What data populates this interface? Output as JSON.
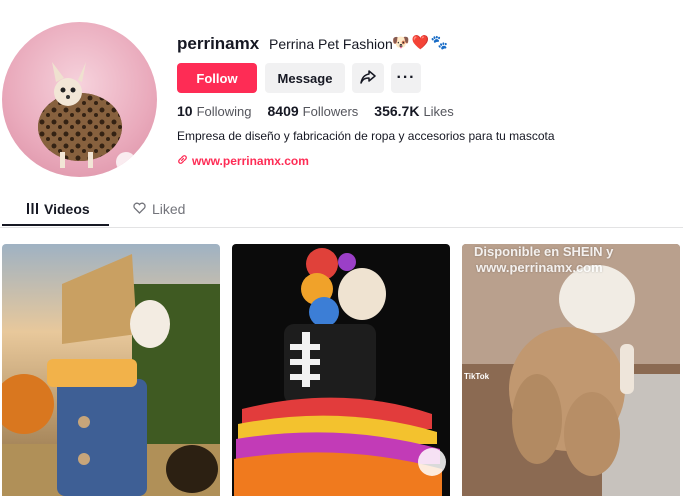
{
  "profile": {
    "username": "perrinamx",
    "nickname": "Perrina Pet Fashion",
    "emojis": [
      "dog-face",
      "heart",
      "paw"
    ],
    "bio": "Empresa de diseño y fabricación de ropa y accesorios para tu mascota",
    "link": "www.perrinamx.com"
  },
  "buttons": {
    "follow": "Follow",
    "message": "Message",
    "more": "···"
  },
  "stats": {
    "following_count": "10",
    "following_label": "Following",
    "followers_count": "8409",
    "followers_label": "Followers",
    "likes_count": "356.7K",
    "likes_label": "Likes"
  },
  "tabs": {
    "videos": "Videos",
    "liked": "Liked"
  },
  "videos": [
    {
      "description": "scarecrow-costume"
    },
    {
      "description": "calavera-dress"
    },
    {
      "description": "turkey-costume",
      "watermark_line1": "Disponible en SHEIN y",
      "watermark_line2": "www.perrinamx.com",
      "tiktok_mark": "TikTok"
    }
  ],
  "colors": {
    "accent": "#fe2c55",
    "text": "#161823",
    "secondary": "#f1f1f2"
  }
}
